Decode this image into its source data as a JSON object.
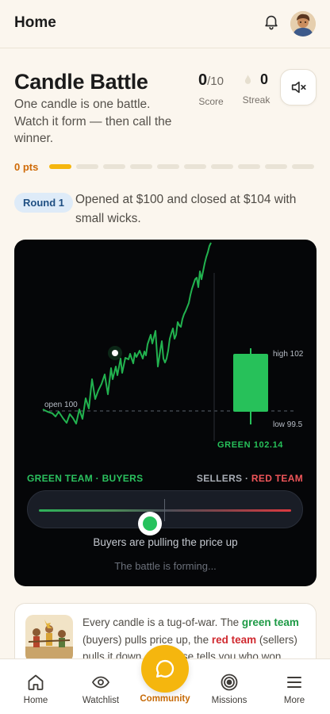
{
  "header": {
    "title": "Home",
    "icons": [
      "bell-icon",
      "avatar"
    ]
  },
  "game": {
    "title": "Candle Battle",
    "subtitle": "One candle is one battle. Watch it form — then call the winner.",
    "score": {
      "value": "0",
      "total": "/10",
      "label": "Score"
    },
    "streak": {
      "value": "0",
      "label": "Streak",
      "icon": "flame-icon"
    },
    "mute_icon": "speaker-mute-icon",
    "points": "0 pts",
    "progress": {
      "current": 1,
      "total": 10,
      "active_color": "#f5b60e"
    }
  },
  "round": {
    "badge": "Round 1",
    "description": "Opened at $100 and closed at $104 with small wicks."
  },
  "battle": {
    "open_label": "open 100",
    "high_label": "high 102",
    "low_label": "low 99.5",
    "result_label": "GREEN 102.14",
    "green_team": "GREEN TEAM · BUYERS",
    "red_team_sellers": "SELLERS · ",
    "red_team_red": "RED TEAM",
    "status": "Buyers are pulling the price up",
    "forming": "The battle is forming...",
    "tug_position": 0.4,
    "colors": {
      "green": "#27c15a",
      "red": "#f0565a",
      "background": "#050608"
    }
  },
  "info": {
    "text_1": "Every candle is a tug-of-war. The ",
    "green_team": "green team",
    "text_2": " (buyers) pulls price up, the ",
    "red_team": "red team",
    "text_3": " (sellers) pulls it down. The close tells you who won."
  },
  "nav": {
    "items": [
      {
        "label": "Home",
        "icon": "home-icon"
      },
      {
        "label": "Watchlist",
        "icon": "eye-icon"
      },
      {
        "label": "Community",
        "icon": "chat-bubble-icon"
      },
      {
        "label": "Missions",
        "icon": "target-icon"
      },
      {
        "label": "More",
        "icon": "menu-icon"
      }
    ],
    "accent": "#f5b60e"
  }
}
